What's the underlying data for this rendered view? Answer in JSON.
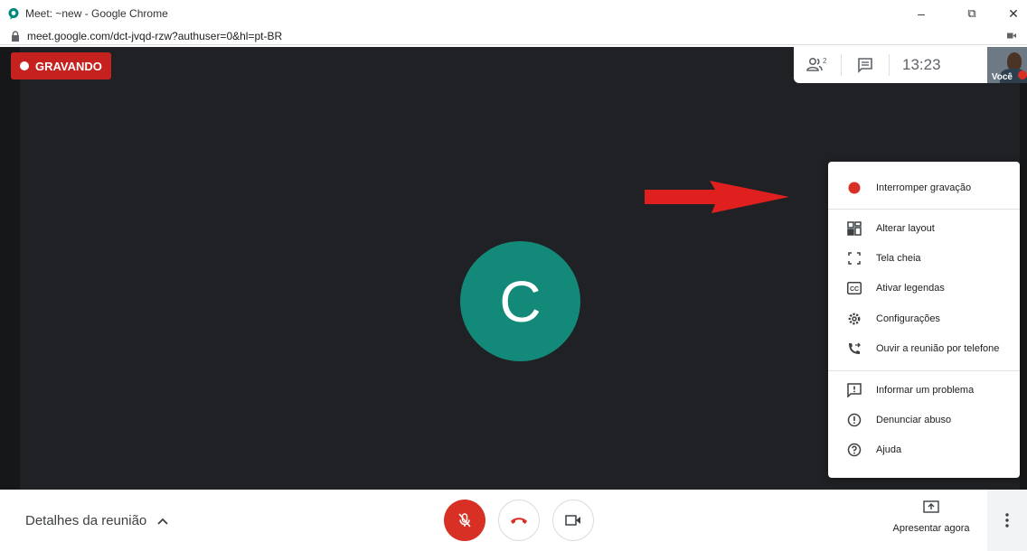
{
  "browser": {
    "window_title": "Meet: ~new - Google Chrome",
    "url": "meet.google.com/dct-jvqd-rzw?authuser=0&hl=pt-BR",
    "minimize": "–",
    "restore": "⧉",
    "close": "✕"
  },
  "meeting": {
    "recording_label": "GRAVANDO",
    "participants_count": "2",
    "clock": "13:23",
    "self_label": "Você",
    "participant_initial": "C"
  },
  "menu": {
    "items": [
      {
        "label": "Interromper gravação",
        "icon": "record-dot-icon"
      },
      {
        "label": "Alterar layout",
        "icon": "layout-icon"
      },
      {
        "label": "Tela cheia",
        "icon": "fullscreen-icon"
      },
      {
        "label": "Ativar legendas",
        "icon": "closed-captions-icon"
      },
      {
        "label": "Configurações",
        "icon": "settings-gear-icon"
      },
      {
        "label": "Ouvir a reunião por telefone",
        "icon": "phone-forward-icon"
      },
      {
        "label": "Informar um problema",
        "icon": "feedback-icon"
      },
      {
        "label": "Denunciar abuso",
        "icon": "report-icon"
      },
      {
        "label": "Ajuda",
        "icon": "help-icon"
      }
    ]
  },
  "bottombar": {
    "details_label": "Detalhes da reunião",
    "present_label": "Apresentar agora"
  },
  "colors": {
    "recording_red": "#c5221f",
    "avatar_teal": "#138a79",
    "stage_bg": "#202124",
    "mic_off_red": "#d93025"
  }
}
